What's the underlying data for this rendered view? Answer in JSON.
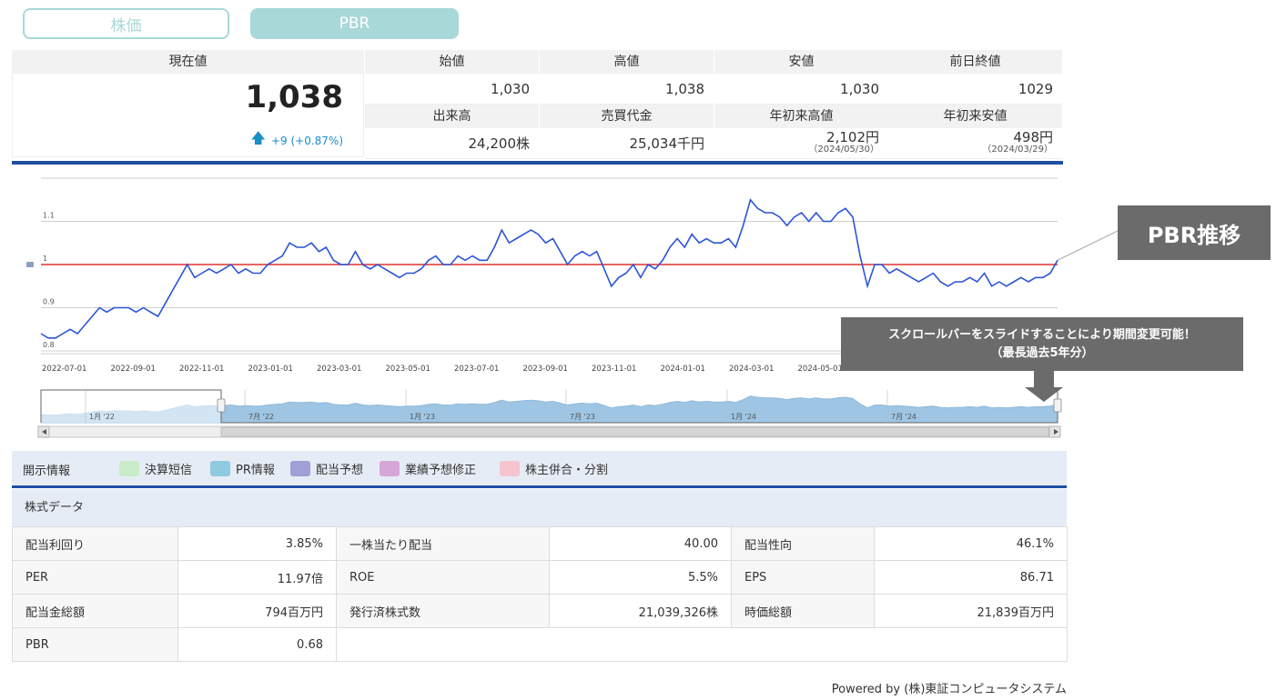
{
  "tabs": [
    {
      "label": "株価",
      "active": false
    },
    {
      "label": "PBR",
      "active": true
    }
  ],
  "quote": {
    "current_label": "現在値",
    "current_value": "1,038",
    "change": "+9 (+0.87%)",
    "cells": [
      {
        "label": "始値",
        "value": "1,030"
      },
      {
        "label": "高値",
        "value": "1,038"
      },
      {
        "label": "安値",
        "value": "1,030"
      },
      {
        "label": "前日終値",
        "value": "1029"
      },
      {
        "label": "出来高",
        "value": "24,200株"
      },
      {
        "label": "売買代金",
        "value": "25,034千円"
      },
      {
        "label": "年初来高値",
        "value": "2,102円",
        "sub": "（2024/05/30）"
      },
      {
        "label": "年初来安値",
        "value": "498円",
        "sub": "（2024/03/29）"
      }
    ]
  },
  "colors": {
    "accent": "#1f4ea3",
    "tab": "#a9d8d8",
    "line": "#2b55d6",
    "ref": "#e03030",
    "nav_fill": "#9ec5e3"
  },
  "chart_data": {
    "type": "line",
    "series": [
      {
        "values": [
          0.84,
          0.83,
          0.83,
          0.84,
          0.85,
          0.84,
          0.86,
          0.88,
          0.9,
          0.89,
          0.9,
          0.9,
          0.9,
          0.89,
          0.9,
          0.89,
          0.88,
          0.91,
          0.94,
          0.97,
          1.0,
          0.97,
          0.98,
          0.99,
          0.98,
          0.99,
          1.0,
          0.98,
          0.99,
          0.98,
          0.98,
          1.0,
          1.01,
          1.02,
          1.05,
          1.04,
          1.04,
          1.05,
          1.03,
          1.04,
          1.01,
          1.0,
          1.0,
          1.03,
          1.0,
          0.99,
          1.0,
          0.99,
          0.98,
          0.97,
          0.98,
          0.98,
          0.99,
          1.01,
          1.02,
          1.0,
          1.0,
          1.02,
          1.01,
          1.02,
          1.01,
          1.01,
          1.04,
          1.08,
          1.05,
          1.06,
          1.07,
          1.08,
          1.07,
          1.05,
          1.06,
          1.03,
          1.0,
          1.02,
          1.03,
          1.02,
          1.03,
          0.99,
          0.95,
          0.97,
          0.98,
          1.0,
          0.97,
          1.0,
          0.99,
          1.01,
          1.04,
          1.06,
          1.04,
          1.07,
          1.05,
          1.06,
          1.05,
          1.05,
          1.06,
          1.04,
          1.09,
          1.15,
          1.13,
          1.12,
          1.12,
          1.11,
          1.09,
          1.11,
          1.12,
          1.1,
          1.12,
          1.1,
          1.1,
          1.12,
          1.13,
          1.11,
          1.02,
          0.95,
          1.0,
          1.0,
          0.98,
          0.99,
          0.98,
          0.97,
          0.96,
          0.97,
          0.98,
          0.96,
          0.95,
          0.96,
          0.96,
          0.97,
          0.96,
          0.98,
          0.95,
          0.96,
          0.95,
          0.96,
          0.97,
          0.96,
          0.97,
          0.97,
          0.98,
          1.01
        ]
      }
    ],
    "x_ticks": [
      "2022-07-01",
      "2022-09-01",
      "2022-11-01",
      "2023-01-01",
      "2023-03-01",
      "2023-05-01",
      "2023-07-01",
      "2023-09-01",
      "2023-11-01",
      "2024-01-01",
      "2024-03-01",
      "2024-05-01"
    ],
    "y_ticks": [
      "1.1",
      "1",
      "0.9",
      "0.8"
    ],
    "y_range": [
      0.8,
      1.2
    ],
    "ref_line": 1.0,
    "navigator_labels": [
      "1月 '22",
      "7月 '22",
      "1月 '23",
      "7月 '23",
      "1月 '24",
      "7月 '24"
    ]
  },
  "annotations": {
    "pbr_label": "PBR推移",
    "scroll_line1": "スクロールバーをスライドすることにより期間変更可能！",
    "scroll_line2": "（最長過去5年分）"
  },
  "legend": {
    "title": "開示情報",
    "items": [
      {
        "label": "決算短信",
        "color": "#c8ecc8"
      },
      {
        "label": "PR情報",
        "color": "#8fcbe0"
      },
      {
        "label": "配当予想",
        "color": "#a09fd6"
      },
      {
        "label": "業績予想修正",
        "color": "#d6a6d6"
      },
      {
        "label": "株主併合・分割",
        "color": "#f5c4cf"
      }
    ]
  },
  "stock_data": {
    "title": "株式データ",
    "rows": [
      [
        {
          "label": "配当利回り",
          "value": "3.85%"
        },
        {
          "label": "一株当たり配当",
          "value": "40.00"
        },
        {
          "label": "配当性向",
          "value": "46.1%"
        }
      ],
      [
        {
          "label": "PER",
          "value": "11.97倍"
        },
        {
          "label": "ROE",
          "value": "5.5%"
        },
        {
          "label": "EPS",
          "value": "86.71"
        }
      ],
      [
        {
          "label": "配当金総額",
          "value": "794百万円"
        },
        {
          "label": "発行済株式数",
          "value": "21,039,326株"
        },
        {
          "label": "時価総額",
          "value": "21,839百万円"
        }
      ],
      [
        {
          "label": "PBR",
          "value": "0.68"
        }
      ]
    ]
  },
  "footer": "Powered by (株)東証コンピュータシステム"
}
